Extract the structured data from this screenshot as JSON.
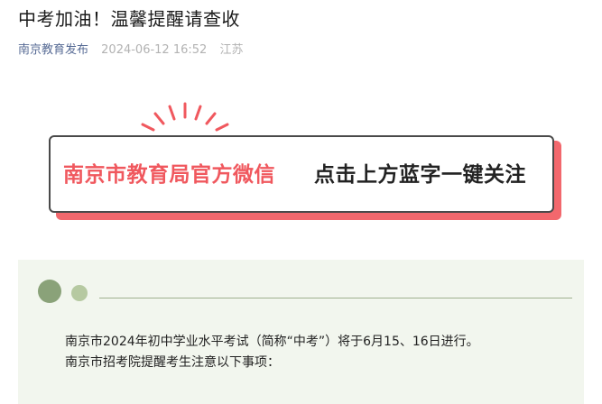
{
  "article": {
    "title": "中考加油！温馨提醒请查收",
    "author": "南京教育发布",
    "datetime": "2024-06-12 16:52",
    "location": "江苏"
  },
  "banner": {
    "left_text": "南京市教育局官方微信",
    "right_text": "点击上方蓝字一键关注",
    "accent_color": "#f0585e",
    "shadow_color": "#f2686d"
  },
  "notice": {
    "bg_color": "#f2f6ee",
    "line1": "南京市2024年初中学业水平考试（简称“中考”）将于6月15、16日进行。",
    "line2": "南京市招考院提醒考生注意以下事项："
  }
}
